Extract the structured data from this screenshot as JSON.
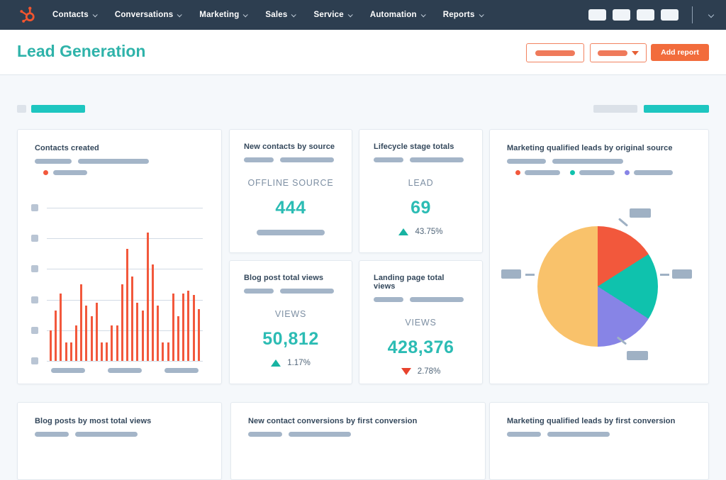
{
  "colors": {
    "nav_bg": "#2d3e50",
    "accent_orange": "#f26c3c",
    "accent_teal": "#2fb3aa",
    "chart_red": "#f2583c",
    "placeholder_gray": "#a4b5c8",
    "title_text": "#33475b"
  },
  "nav": {
    "logo": "hubspot-sprocket",
    "items": [
      "Contacts",
      "Conversations",
      "Marketing",
      "Sales",
      "Service",
      "Automation",
      "Reports"
    ],
    "right_icon_placeholders": 4
  },
  "header": {
    "title": "Lead Generation",
    "add_report_label": "Add report"
  },
  "cards": {
    "contacts_created": {
      "title": "Contacts created"
    },
    "new_contacts_by_source": {
      "title": "New contacts by source",
      "metric_label": "OFFLINE SOURCE",
      "value": "444"
    },
    "lifecycle_stage_totals": {
      "title": "Lifecycle stage totals",
      "metric_label": "LEAD",
      "value": "69",
      "delta": "43.75%",
      "delta_direction": "up"
    },
    "mql_original_source": {
      "title": "Marketing qualified leads by original source"
    },
    "blog_post_total_views": {
      "title": "Blog post total views",
      "metric_label": "VIEWS",
      "value": "50,812",
      "delta": "1.17%",
      "delta_direction": "up"
    },
    "landing_page_total_views": {
      "title": "Landing page total views",
      "metric_label": "VIEWS",
      "value": "428,376",
      "delta": "2.78%",
      "delta_direction": "down"
    },
    "blog_posts_most_views": {
      "title": "Blog posts by most total views"
    },
    "new_contact_conversions": {
      "title": "New contact conversions by first conversion"
    },
    "mql_first_conversion": {
      "title": "Marketing qualified leads by first conversion"
    }
  },
  "chart_data": [
    {
      "type": "bar",
      "title": "Contacts created",
      "values": [
        1.0,
        1.65,
        2.2,
        0.6,
        0.6,
        1.15,
        2.5,
        1.8,
        1.45,
        1.9,
        0.6,
        0.6,
        1.15,
        1.15,
        2.5,
        3.65,
        2.75,
        1.9,
        1.65,
        4.2,
        3.15,
        1.8,
        0.6,
        0.6,
        2.2,
        1.45,
        2.2,
        2.3,
        2.15,
        1.7
      ],
      "ylim": [
        0,
        5
      ],
      "gridlines": 6,
      "bar_color": "#f2583c",
      "x_tick_labels": "redacted-placeholders",
      "y_tick_labels": "redacted-placeholders",
      "legend": "single series, red-orange dot, redacted label"
    },
    {
      "type": "pie",
      "title": "Marketing qualified leads by original source",
      "slices": [
        {
          "name": "slice-1",
          "percent": 16,
          "color": "#f2583c"
        },
        {
          "name": "slice-2",
          "percent": 18,
          "color": "#0fc2ad"
        },
        {
          "name": "slice-3",
          "percent": 16,
          "color": "#8784e6"
        },
        {
          "name": "slice-4",
          "percent": 50,
          "color": "#f9c26b"
        }
      ],
      "start_angle_deg": 0,
      "legend": "three dots (red-orange, teal, purple) with redacted labels",
      "callout_labels": "4 redacted gray callouts: top-right, right, bottom-right, left"
    }
  ]
}
